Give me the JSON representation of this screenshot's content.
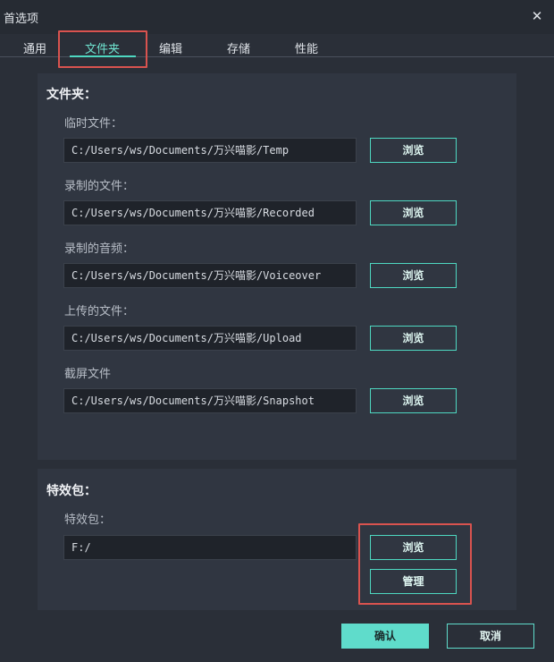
{
  "window": {
    "title": "首选项",
    "close_glyph": "✕"
  },
  "tabs": [
    {
      "label": "通用"
    },
    {
      "label": "文件夹"
    },
    {
      "label": "编辑"
    },
    {
      "label": "存储"
    },
    {
      "label": "性能"
    }
  ],
  "active_tab": "文件夹",
  "folders": {
    "title": "文件夹：",
    "items": [
      {
        "label": "临时文件：",
        "path": "C:/Users/ws/Documents/万兴喵影/Temp",
        "button": "浏览"
      },
      {
        "label": "录制的文件：",
        "path": "C:/Users/ws/Documents/万兴喵影/Recorded",
        "button": "浏览"
      },
      {
        "label": "录制的音频：",
        "path": "C:/Users/ws/Documents/万兴喵影/Voiceover",
        "button": "浏览"
      },
      {
        "label": "上传的文件：",
        "path": "C:/Users/ws/Documents/万兴喵影/Upload",
        "button": "浏览"
      },
      {
        "label": "截屏文件",
        "path": "C:/Users/ws/Documents/万兴喵影/Snapshot",
        "button": "浏览"
      }
    ]
  },
  "effects": {
    "title": "特效包：",
    "label": "特效包：",
    "path": "F:/",
    "browse_button": "浏览",
    "manage_button": "管理"
  },
  "footer": {
    "ok": "确认",
    "cancel": "取消"
  },
  "colors": {
    "accent": "#4ed8c1",
    "background": "#2a2f38",
    "panel": "#303641",
    "highlight": "#d9534f"
  }
}
